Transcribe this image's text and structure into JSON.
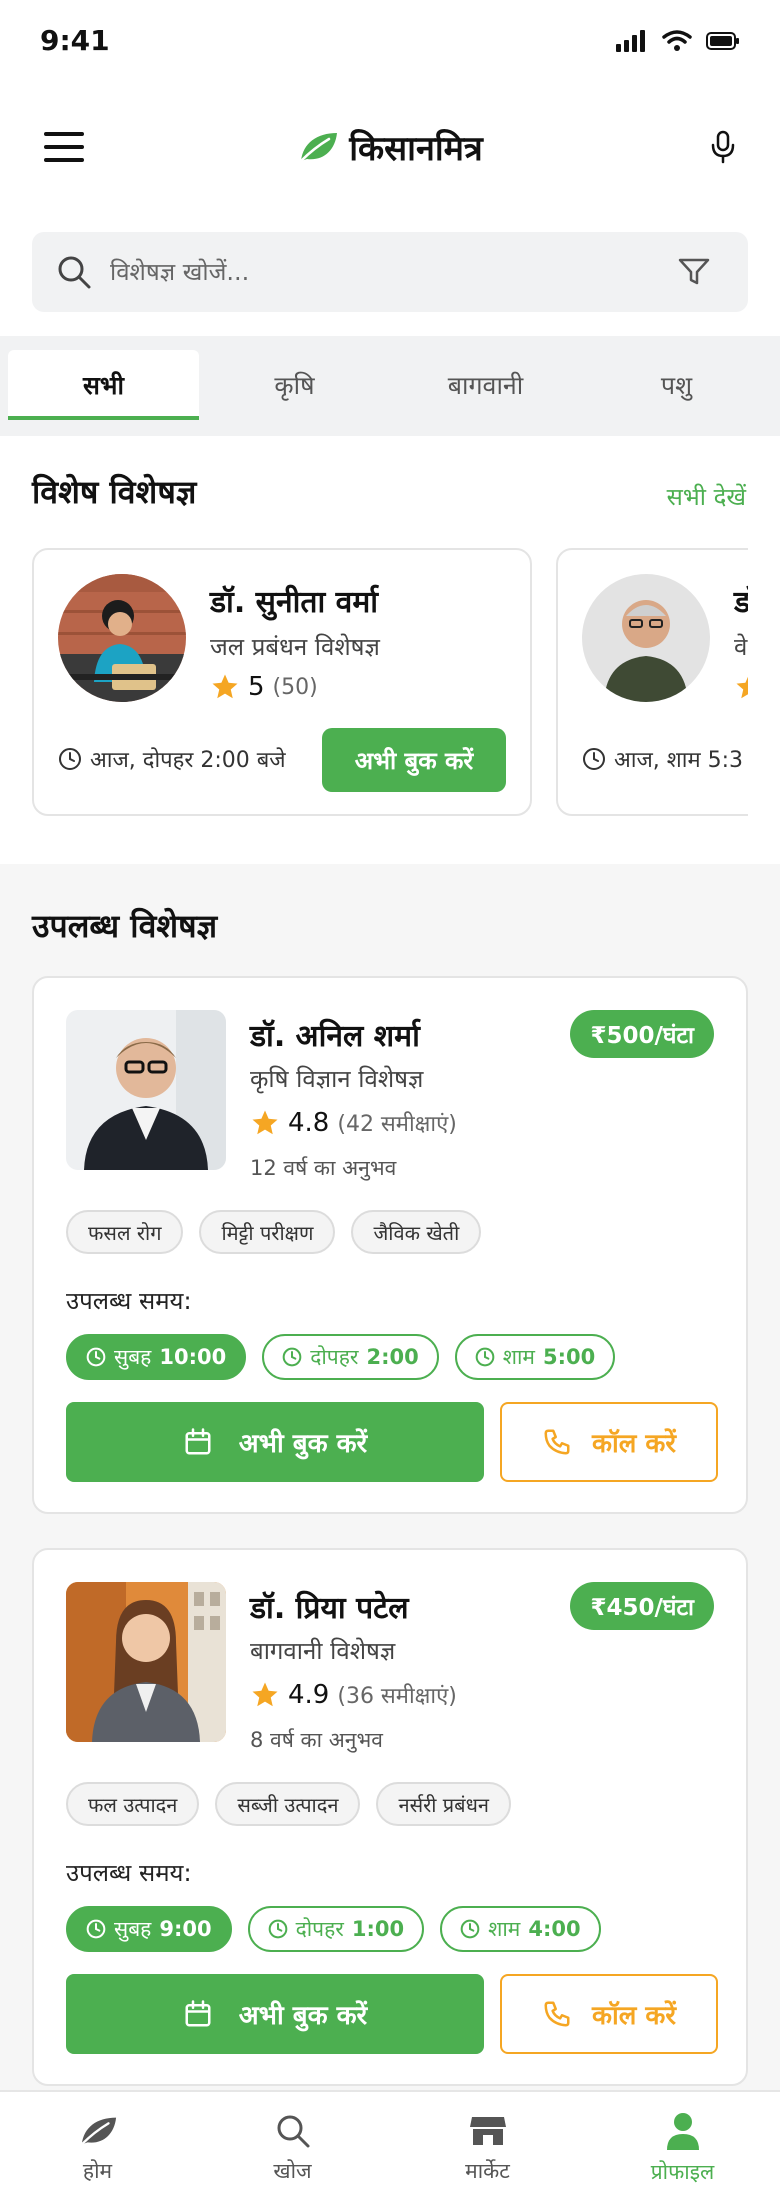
{
  "status": {
    "time": "9:41"
  },
  "header": {
    "brand": "किसानमित्र"
  },
  "search": {
    "placeholder": "विशेषज्ञ खोजें..."
  },
  "tabs": [
    {
      "label": "सभी",
      "active": true
    },
    {
      "label": "कृषि"
    },
    {
      "label": "बागवानी"
    },
    {
      "label": "पशु"
    }
  ],
  "featured": {
    "title": "विशेष विशेषज्ञ",
    "see_all": "सभी देखें",
    "cards": [
      {
        "name": "डॉ. सुनीता वर्मा",
        "specialty": "जल प्रबंधन विशेषज्ञ",
        "rating": "5",
        "reviews": "(50)",
        "time": "आज, दोपहर 2:00 बजे",
        "book": "अभी बुक करें"
      },
      {
        "name": "डॉ.",
        "specialty": "वे",
        "time": "आज, शाम 5:3"
      }
    ]
  },
  "available": {
    "title": "उपलब्ध विशेषज्ञ",
    "slots_label": "उपलब्ध समय:",
    "book": "अभी बुक करें",
    "call": "कॉल करें",
    "experts": [
      {
        "name": "डॉ. अनिल शर्मा",
        "specialty": "कृषि विज्ञान विशेषज्ञ",
        "rating": "4.8",
        "reviews": "(42 समीक्षाएं)",
        "experience": "12 वर्ष का अनुभव",
        "price": "₹500/घंटा",
        "tags": [
          "फसल रोग",
          "मिट्टी परीक्षण",
          "जैविक खेती"
        ],
        "slots": [
          {
            "period": "सुबह",
            "time": "10:00"
          },
          {
            "period": "दोपहर",
            "time": "2:00"
          },
          {
            "period": "शाम",
            "time": "5:00"
          }
        ]
      },
      {
        "name": "डॉ. प्रिया पटेल",
        "specialty": "बागवानी विशेषज्ञ",
        "rating": "4.9",
        "reviews": "(36 समीक्षाएं)",
        "experience": "8 वर्ष का अनुभव",
        "price": "₹450/घंटा",
        "tags": [
          "फल उत्पादन",
          "सब्जी उत्पादन",
          "नर्सरी प्रबंधन"
        ],
        "slots": [
          {
            "period": "सुबह",
            "time": "9:00"
          },
          {
            "period": "दोपहर",
            "time": "1:00"
          },
          {
            "period": "शाम",
            "time": "4:00"
          }
        ]
      }
    ]
  },
  "bottom_nav": [
    {
      "label": "होम",
      "icon": "leaf-icon"
    },
    {
      "label": "खोज",
      "icon": "search-icon"
    },
    {
      "label": "मार्केट",
      "icon": "store-icon"
    },
    {
      "label": "प्रोफाइल",
      "icon": "user-icon",
      "active": true
    }
  ],
  "colors": {
    "primary": "#4caf50",
    "accent": "#f5a623",
    "star": "#f5a623"
  }
}
